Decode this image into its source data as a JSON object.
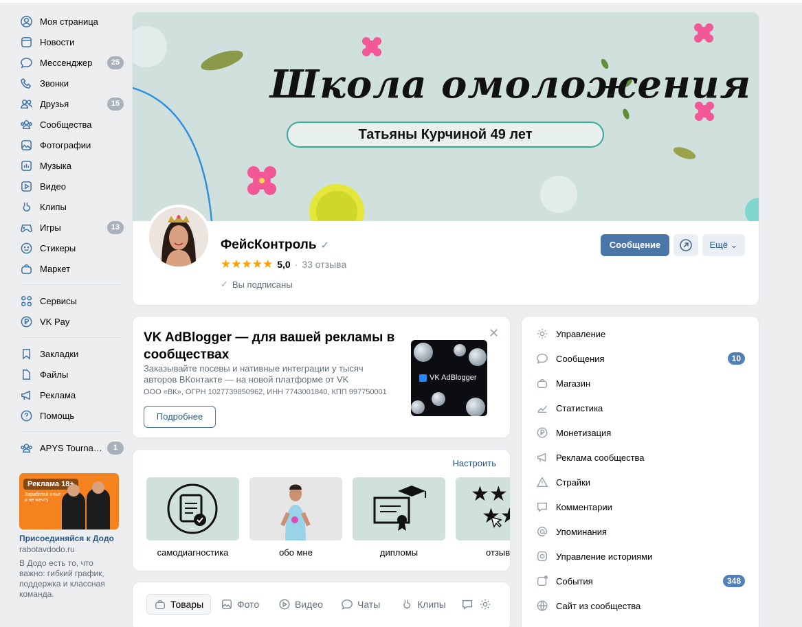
{
  "sidebar": {
    "items": [
      {
        "label": "Моя страница",
        "icon": "user-circle-icon",
        "badge": ""
      },
      {
        "label": "Новости",
        "icon": "news-icon",
        "badge": ""
      },
      {
        "label": "Мессенджер",
        "icon": "message-icon",
        "badge": "25"
      },
      {
        "label": "Звонки",
        "icon": "phone-icon",
        "badge": ""
      },
      {
        "label": "Друзья",
        "icon": "friends-icon",
        "badge": "15"
      },
      {
        "label": "Сообщества",
        "icon": "communities-icon",
        "badge": ""
      },
      {
        "label": "Фотографии",
        "icon": "photo-icon",
        "badge": ""
      },
      {
        "label": "Музыка",
        "icon": "music-icon",
        "badge": ""
      },
      {
        "label": "Видео",
        "icon": "video-icon",
        "badge": ""
      },
      {
        "label": "Клипы",
        "icon": "clips-icon",
        "badge": ""
      },
      {
        "label": "Игры",
        "icon": "games-icon",
        "badge": "13"
      },
      {
        "label": "Стикеры",
        "icon": "sticker-icon",
        "badge": ""
      },
      {
        "label": "Маркет",
        "icon": "market-icon",
        "badge": ""
      }
    ],
    "items2": [
      {
        "label": "Сервисы",
        "icon": "services-icon"
      },
      {
        "label": "VK Pay",
        "icon": "vkpay-icon"
      }
    ],
    "items3": [
      {
        "label": "Закладки",
        "icon": "bookmark-icon"
      },
      {
        "label": "Файлы",
        "icon": "file-icon"
      },
      {
        "label": "Реклама",
        "icon": "megaphone-icon"
      },
      {
        "label": "Помощь",
        "icon": "help-icon"
      }
    ],
    "community": {
      "label": "APYS Tournam...",
      "badge": "1"
    },
    "ad": {
      "label": "Реклама 18+",
      "image_text": "Заработай опыт и не мечту",
      "title": "Присоединяйся к Додо",
      "url": "rabotavdodo.ru",
      "desc": "В Додо есть то, что важно: гибкий график, поддержка и классная команда."
    }
  },
  "cover": {
    "title": "Школа омоложения",
    "subtitle": "Татьяны Курчиной 49 лет"
  },
  "profile": {
    "name": "ФейсКонтроль",
    "stars": "★★★★★",
    "rating": "5,0",
    "dot": "·",
    "reviews": "33 отзыва",
    "subscribed": "Вы подписаны",
    "message_button": "Сообщение",
    "more_button": "Ещё ⌄"
  },
  "adblogger": {
    "title": "VK AdBlogger — для вашей рекламы в сообществах",
    "desc": "Заказывайте посевы и нативные интеграции у тысяч авторов ВКонтакте — на новой платформе от VK",
    "legal": "ООО «ВК», ОГРН 1027739850962, ИНН 7743001840, КПП 997750001",
    "button": "Подробнее",
    "image_brand": "VK AdBlogger",
    "close": "✕"
  },
  "highlights": {
    "setup": "Настроить",
    "items": [
      {
        "label": "самодиагностика",
        "icon": "clipboard-check-icon"
      },
      {
        "label": "обо мне",
        "icon": "photo-woman"
      },
      {
        "label": "дипломы",
        "icon": "diploma-icon"
      },
      {
        "label": "отзыв",
        "icon": "stars-icon"
      }
    ]
  },
  "tabs": [
    {
      "label": "Товары",
      "icon": "bag-icon",
      "active": true
    },
    {
      "label": "Фото",
      "icon": "photo-icon",
      "active": false
    },
    {
      "label": "Видео",
      "icon": "video-icon",
      "active": false
    },
    {
      "label": "Чаты",
      "icon": "chat-icon",
      "active": false
    },
    {
      "label": "Клипы",
      "icon": "clips-icon",
      "active": false
    }
  ],
  "menu": [
    {
      "label": "Управление",
      "icon": "gear-icon",
      "badge": ""
    },
    {
      "label": "Сообщения",
      "icon": "message-icon",
      "badge": "10"
    },
    {
      "label": "Магазин",
      "icon": "shop-icon",
      "badge": ""
    },
    {
      "label": "Статистика",
      "icon": "stats-icon",
      "badge": ""
    },
    {
      "label": "Монетизация",
      "icon": "ruble-icon",
      "badge": ""
    },
    {
      "label": "Реклама сообщества",
      "icon": "megaphone-icon",
      "badge": ""
    },
    {
      "label": "Страйки",
      "icon": "warning-icon",
      "badge": ""
    },
    {
      "label": "Комментарии",
      "icon": "comment-icon",
      "badge": ""
    },
    {
      "label": "Упоминания",
      "icon": "at-icon",
      "badge": ""
    },
    {
      "label": "Управление историями",
      "icon": "stories-icon",
      "badge": ""
    },
    {
      "label": "События",
      "icon": "events-icon",
      "badge": "348"
    },
    {
      "label": "Сайт из сообщества",
      "icon": "globe-icon",
      "badge": ""
    }
  ],
  "colors": {
    "accent": "#4a76a8",
    "badge_gray": "#a9b1bb",
    "badge_blue": "#5181b8",
    "cover_bg": "#cfe0dd",
    "star": "#ffa000"
  }
}
